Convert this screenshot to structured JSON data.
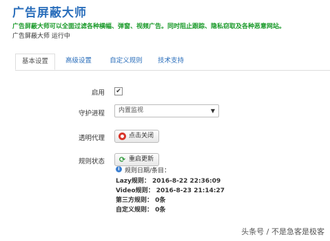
{
  "header": {
    "title": "广告屏蔽大师",
    "subtitle": "广告屏蔽大师可以全面过滤各种横幅、弹窗、视频广告。同时阻止跟踪、隐私窃取及各种恶意网站。",
    "status": "广告屏蔽大师 运行中"
  },
  "tabs": [
    {
      "label": "基本设置",
      "active": true
    },
    {
      "label": "高级设置",
      "active": false
    },
    {
      "label": "自定义规则",
      "active": false
    },
    {
      "label": "技术支持",
      "active": false
    }
  ],
  "form": {
    "enable_label": "启用",
    "enable_checked": true,
    "check_mark": "✔",
    "daemon_label": "守护进程",
    "daemon_value": "内置监视",
    "dropdown_arrow": "▼",
    "proxy_label": "透明代理",
    "proxy_button": "点击关闭",
    "rules_label": "规则状态",
    "update_button": "重启更新",
    "update_icon": "⟳",
    "rules_header": "规则日期/条目：",
    "info_icon": "i",
    "lazy_rule": "Lazy规则：  2016-8-22 22:36:09",
    "video_rule": "Video规则：  2016-8-23 21:14:27",
    "third_party_rule": "第三方规则：  0条",
    "custom_rule": "自定义规则：  0条"
  },
  "watermark": "头条号 / 不是急客是极客",
  "colors": {
    "title": "#2a6ebb",
    "subtitle": "#1a9a2a",
    "tab_link": "#2a6ebb",
    "stop_icon": "#d8352a",
    "refresh_icon": "#2e9a3a"
  }
}
